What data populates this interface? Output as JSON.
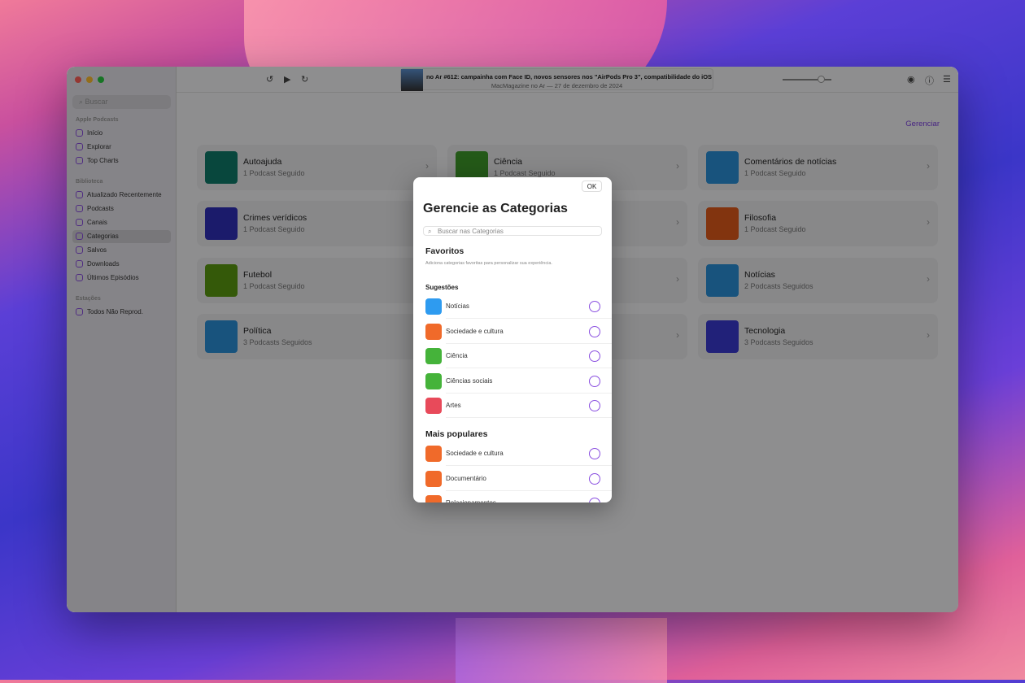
{
  "sidebar": {
    "search_placeholder": "Buscar",
    "sections": [
      {
        "title": "Apple Podcasts",
        "items": [
          {
            "label": "Início",
            "icon": "house-icon"
          },
          {
            "label": "Explorar",
            "icon": "grid-icon"
          },
          {
            "label": "Top Charts",
            "icon": "list-icon"
          }
        ]
      },
      {
        "title": "Biblioteca",
        "items": [
          {
            "label": "Atualizado Recentemente",
            "icon": "check-circle-icon"
          },
          {
            "label": "Podcasts",
            "icon": "podcasts-icon"
          },
          {
            "label": "Canais",
            "icon": "channels-icon"
          },
          {
            "label": "Categorias",
            "icon": "cube-icon",
            "selected": true
          },
          {
            "label": "Salvos",
            "icon": "bookmark-icon"
          },
          {
            "label": "Downloads",
            "icon": "download-icon"
          },
          {
            "label": "Últimos Episódios",
            "icon": "clock-icon"
          }
        ]
      },
      {
        "title": "Estações",
        "items": [
          {
            "label": "Todos Não Reprod.",
            "icon": "gear-icon"
          }
        ]
      }
    ]
  },
  "player": {
    "title": "no Ar #612: campainha com Face ID, novos sensores nos \"AirPods Pro 3\", compatibilidade do iOS",
    "subtitle": "MacMagazine no Ar — 27 de dezembro de 2024",
    "volume": 0.8
  },
  "main": {
    "manage_label": "Gerenciar",
    "cards": [
      {
        "title": "Autoajuda",
        "sub": "1 Podcast Seguido",
        "color": "#0f7a6a"
      },
      {
        "title": "Ciência",
        "sub": "1 Podcast Seguido",
        "color": "#3f9a2a"
      },
      {
        "title": "Comentários de notícias",
        "sub": "1 Podcast Seguido",
        "color": "#2a8fd8"
      },
      {
        "title": "Crimes verídicos",
        "sub": "1 Podcast Seguido",
        "color": "#2f2fb8"
      },
      {
        "title": "",
        "sub": "",
        "color": ""
      },
      {
        "title": "Filosofia",
        "sub": "1 Podcast Seguido",
        "color": "#e05a1a"
      },
      {
        "title": "Futebol",
        "sub": "1 Podcast Seguido",
        "color": "#5a9a10"
      },
      {
        "title": "",
        "sub": "",
        "color": ""
      },
      {
        "title": "Notícias",
        "sub": "2 Podcasts Seguidos",
        "color": "#2a8fd8"
      },
      {
        "title": "Política",
        "sub": "3 Podcasts Seguidos",
        "color": "#2a8fd8"
      },
      {
        "title": "",
        "sub": "",
        "color": ""
      },
      {
        "title": "Tecnologia",
        "sub": "3 Podcasts Seguidos",
        "color": "#3a3ad0"
      }
    ]
  },
  "modal": {
    "ok": "OK",
    "title": "Gerencie as Categorias",
    "search_placeholder": "Buscar nas Categorias",
    "favorites": "Favoritos",
    "favorites_desc": "Adiciona categorias favoritas para personalizar sua experiência.",
    "suggestions": "Sugestões",
    "popular": "Mais populares",
    "suggestion_items": [
      {
        "label": "Notícias",
        "color": "#2e9bf0"
      },
      {
        "label": "Sociedade e cultura",
        "color": "#f06a2a"
      },
      {
        "label": "Ciência",
        "color": "#45b33a"
      },
      {
        "label": "Ciências sociais",
        "color": "#45b33a"
      },
      {
        "label": "Artes",
        "color": "#e84a5a"
      }
    ],
    "popular_items": [
      {
        "label": "Sociedade e cultura",
        "color": "#f06a2a"
      },
      {
        "label": "Documentário",
        "color": "#f06a2a"
      },
      {
        "label": "Relacionamentos",
        "color": "#f06a2a"
      }
    ]
  }
}
